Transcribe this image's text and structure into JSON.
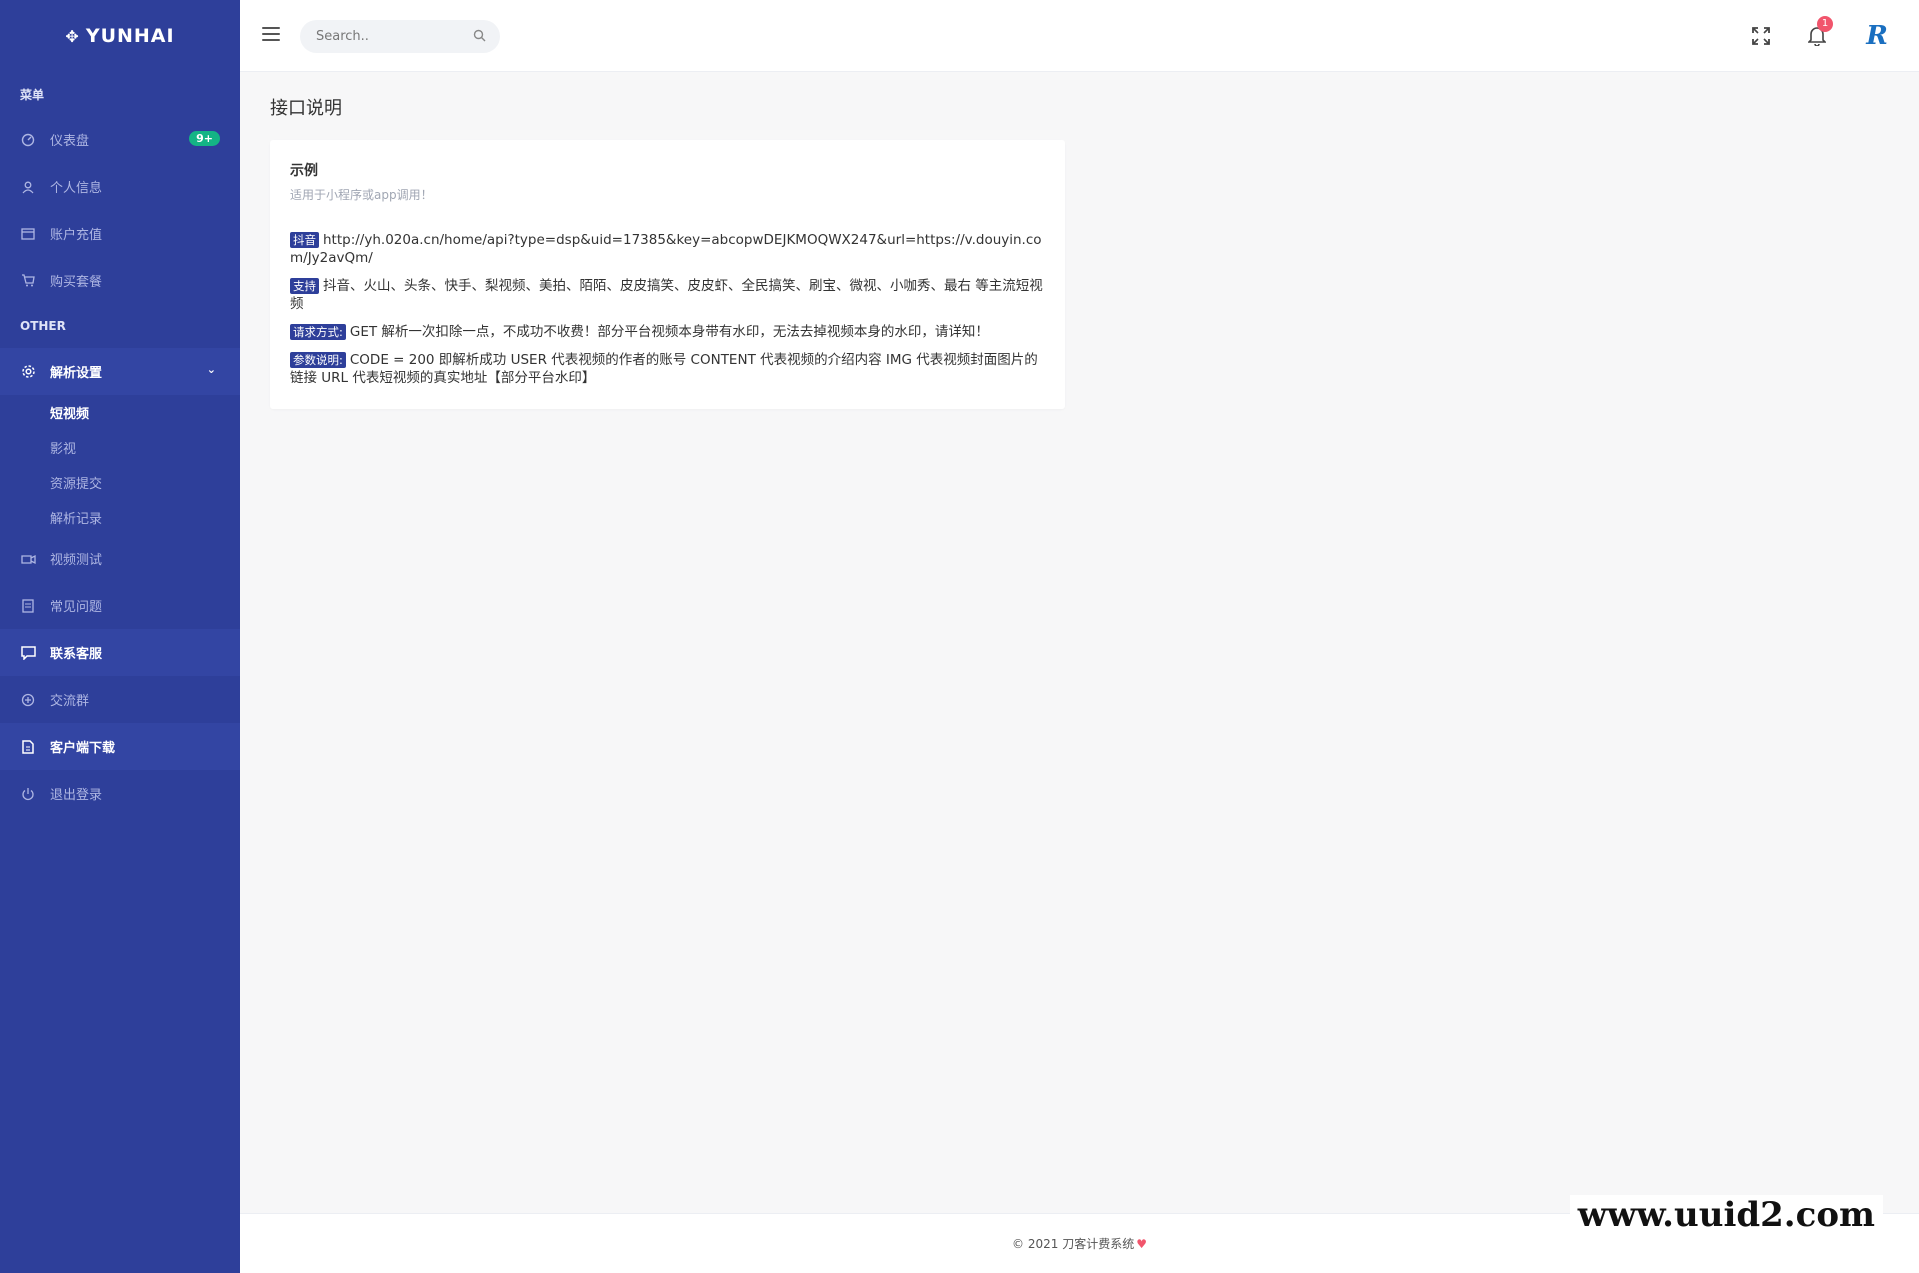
{
  "brand": {
    "name": "YUNHAI",
    "logo_icon": "move-arrows-icon"
  },
  "sidebar": {
    "section_menu": "菜单",
    "section_other": "OTHER",
    "items": [
      {
        "label": "仪表盘",
        "icon": "dashboard-icon",
        "badge": "9+"
      },
      {
        "label": "个人信息",
        "icon": "user-icon"
      },
      {
        "label": "账户充值",
        "icon": "card-icon"
      },
      {
        "label": "购买套餐",
        "icon": "cart-icon"
      }
    ],
    "settings": {
      "label": "解析设置",
      "icon": "gear-icon",
      "children": [
        "短视频",
        "影视",
        "资源提交",
        "解析记录"
      ]
    },
    "others": [
      {
        "label": "视频测试",
        "icon": "video-icon"
      },
      {
        "label": "常见问题",
        "icon": "document-icon"
      },
      {
        "label": "联系客服",
        "icon": "chat-icon"
      },
      {
        "label": "交流群",
        "icon": "group-icon"
      },
      {
        "label": "客户端下载",
        "icon": "download-file-icon"
      },
      {
        "label": "退出登录",
        "icon": "power-icon"
      }
    ]
  },
  "topbar": {
    "search_placeholder": "Search..",
    "notification_count": "1",
    "avatar_letter": "R"
  },
  "page": {
    "title": "接口说明",
    "card": {
      "title": "示例",
      "subtitle": "适用于小程序或app调用！",
      "lines": [
        {
          "tag": "抖音",
          "text": "http://yh.020a.cn/home/api?type=dsp&uid=17385&key=abcopwDEJKMOQWX247&url=https://v.douyin.com/Jy2avQm/"
        },
        {
          "tag": "支持",
          "text": "抖音、火山、头条、快手、梨视频、美拍、陌陌、皮皮搞笑、皮皮虾、全民搞笑、刷宝、微视、小咖秀、最右 等主流短视频"
        },
        {
          "tag": "请求方式:",
          "text": "GET 解析一次扣除一点，不成功不收费！部分平台视频本身带有水印，无法去掉视频本身的水印，请详知！"
        },
        {
          "tag": "参数说明:",
          "text": "CODE = 200 即解析成功 USER 代表视频的作者的账号 CONTENT 代表视频的介绍内容 IMG 代表视频封面图片的链接 URL 代表短视频的真实地址【部分平台水印】"
        }
      ]
    }
  },
  "footer": {
    "text": "© 2021 刀客计费系统"
  },
  "watermark": "www.uuid2.com"
}
